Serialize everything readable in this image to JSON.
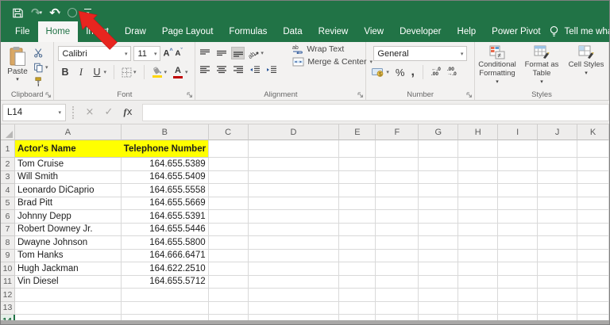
{
  "quick_access": {
    "icons": [
      "save-icon",
      "redo-icon",
      "undo-icon",
      "circle-icon",
      "customize-toolbar-icon"
    ]
  },
  "tabs": [
    {
      "label": "File",
      "active": false
    },
    {
      "label": "Home",
      "active": true
    },
    {
      "label": "Insert",
      "active": false
    },
    {
      "label": "Draw",
      "active": false
    },
    {
      "label": "Page Layout",
      "active": false
    },
    {
      "label": "Formulas",
      "active": false
    },
    {
      "label": "Data",
      "active": false
    },
    {
      "label": "Review",
      "active": false
    },
    {
      "label": "View",
      "active": false
    },
    {
      "label": "Developer",
      "active": false
    },
    {
      "label": "Help",
      "active": false
    },
    {
      "label": "Power Pivot",
      "active": false
    }
  ],
  "tell_me": {
    "label": "Tell me what you want to",
    "icon": "lightbulb-icon"
  },
  "ribbon": {
    "clipboard": {
      "group_label": "Clipboard",
      "paste_label": "Paste"
    },
    "font": {
      "group_label": "Font",
      "font_name": "Calibri",
      "font_size": "11",
      "bold": "B",
      "italic": "I",
      "underline": "U"
    },
    "alignment": {
      "group_label": "Alignment",
      "wrap_text_label": "Wrap Text",
      "merge_center_label": "Merge & Center"
    },
    "number": {
      "group_label": "Number",
      "number_format": "General",
      "percent": "%",
      "comma": ",",
      "increase_decimal": [
        "←.0",
        ".00"
      ],
      "decrease_decimal": [
        ".00",
        "→.0"
      ]
    },
    "styles": {
      "group_label": "Styles",
      "buttons": [
        "Conditional Formatting",
        "Format as Table",
        "Cell Styles"
      ]
    }
  },
  "formula_bar": {
    "name_box_value": "L14",
    "cancel": "×",
    "enter": "✓",
    "function_label": "x",
    "formula_value": ""
  },
  "sheet": {
    "columns": [
      "A",
      "B",
      "C",
      "D",
      "E",
      "F",
      "G",
      "H",
      "I",
      "J",
      "K"
    ],
    "header_row": {
      "col_a": "Actor's Name",
      "col_b": "Telephone Number"
    },
    "data_rows": [
      {
        "name": "Tom Cruise",
        "phone": "164.655.5389"
      },
      {
        "name": "Will Smith",
        "phone": "164.655.5409"
      },
      {
        "name": "Leonardo DiCaprio",
        "phone": "164.655.5558"
      },
      {
        "name": "Brad Pitt",
        "phone": "164.655.5669"
      },
      {
        "name": "Johnny Depp",
        "phone": "164.655.5391"
      },
      {
        "name": "Robert Downey Jr.",
        "phone": "164.655.5446"
      },
      {
        "name": "Dwayne Johnson",
        "phone": "164.655.5800"
      },
      {
        "name": "Tom Hanks",
        "phone": "164.666.6471"
      },
      {
        "name": "Hugh Jackman",
        "phone": "164.622.2510"
      },
      {
        "name": "Vin Diesel",
        "phone": "164.655.5712"
      }
    ],
    "total_rows": 14,
    "active_row": 14,
    "active_cell": "L14",
    "highlight_color": "#ffff00"
  },
  "colors": {
    "title_green": "#217346",
    "arrow_red": "#e8251f",
    "highlight_yellow": "#ffff00"
  }
}
